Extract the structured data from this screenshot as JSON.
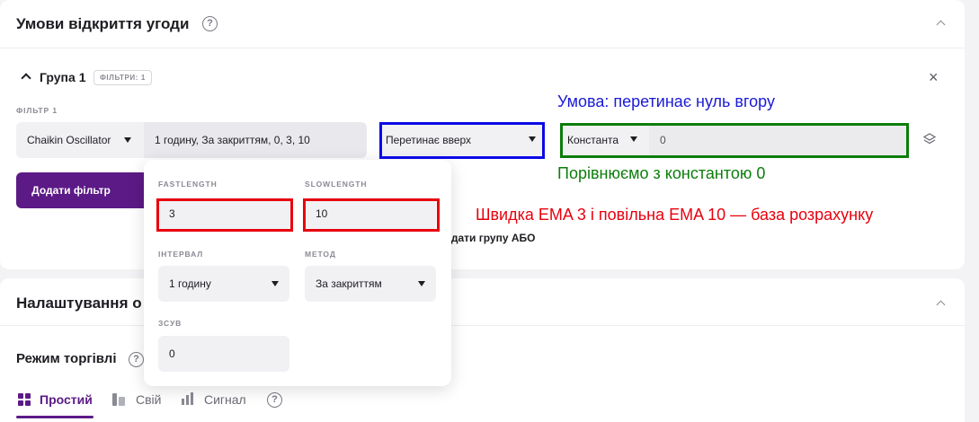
{
  "section1": {
    "title": "Умови відкриття угоди",
    "help": "?"
  },
  "group": {
    "title": "Група 1",
    "badge": "ФІЛЬТРИ: 1",
    "close": "×"
  },
  "filter": {
    "label": "ФІЛЬТР 1",
    "indicator": "Chaikin Oscillator",
    "params_summary": "1 годину, За закриттям, 0, 3, 10",
    "condition": "Перетинає вверх",
    "compare_type": "Константа",
    "compare_value": "0"
  },
  "buttons": {
    "add_filter": "Додати фільтр",
    "add_group_or": "Додати групу АБО"
  },
  "popup": {
    "fastlength": {
      "label": "FASTLENGTH",
      "value": "3"
    },
    "slowlength": {
      "label": "SLOWLENGTH",
      "value": "10"
    },
    "interval": {
      "label": "ІНТЕРВАЛ",
      "value": "1 годину"
    },
    "method": {
      "label": "МЕТОД",
      "value": "За закриттям"
    },
    "shift": {
      "label": "ЗСУВ",
      "value": "0"
    }
  },
  "annotations": {
    "blue": "Умова: перетинає нуль вгору",
    "green": "Порівнюємо з константою 0",
    "red": "Швидка EMA 3 і повільна EMA 10 — база розрахунку"
  },
  "section2": {
    "title": "Налаштування о"
  },
  "trading_mode": {
    "title": "Режим торгівлі",
    "tabs": [
      {
        "label": "Простий",
        "active": true
      },
      {
        "label": "Свій",
        "active": false
      },
      {
        "label": "Сигнал",
        "active": false
      }
    ]
  },
  "colors": {
    "primary": "#5c1a86",
    "anno_red": "#e8000d",
    "anno_blue": "#0a0ae6",
    "anno_green": "#0c7d0c"
  }
}
